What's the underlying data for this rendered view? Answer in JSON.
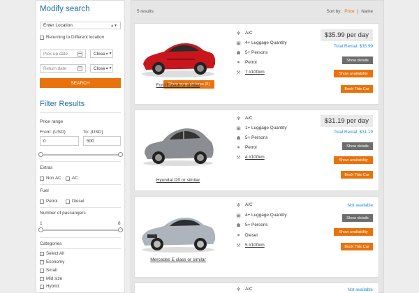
{
  "modify": {
    "title": "Modify search",
    "location": "Enter Location",
    "return_diff": "Returning to Different location",
    "pickup_placeholder": "Pick-up date",
    "return_placeholder": "Return date",
    "time_closed_1": "Close",
    "time_closed_2": "Close",
    "search_btn": "SEARCH"
  },
  "filters": {
    "title": "Filter Results",
    "price_range_label": "Price range",
    "from_label": "From: (USD)",
    "to_label": "To: (USD)",
    "from_value": "0",
    "to_value": "500",
    "extras_label": "Extras",
    "extras": [
      "Non AC",
      "AC"
    ],
    "fuel_label": "Fuel",
    "fuel": [
      "Petrol",
      "Diesel"
    ],
    "passengers_label": "Number of passangers",
    "pass_min": "1",
    "pass_max": "8",
    "categories_label": "Categories",
    "categories": [
      "Select All",
      "Economy",
      "Small",
      "Mid size",
      "Hybrid"
    ]
  },
  "results": {
    "count_text": "5 results",
    "sort_label": "Sort by:",
    "sort_price": "Price",
    "sort_sep": "|",
    "sort_name": "Name"
  },
  "cars": [
    {
      "name": "Ford Fusion or similar",
      "color": "#c8161d",
      "features": [
        "A/C",
        "4+ Luggage Quantity",
        "5+ Persons",
        "Petrol",
        "7 l/100km"
      ],
      "price": "$35.99 per day",
      "total": "Total Rental: $35.99",
      "more_pictures": "Show more pictures (5)",
      "show_details": "Show details",
      "show_availability": "Show availability",
      "book": "Book This Car"
    },
    {
      "name": "Hyundai i20 or similar",
      "color": "#8a8d91",
      "features": [
        "A/C",
        "1+ Luggage Quantity",
        "5+ Persons",
        "Petrol",
        "4 l/100km"
      ],
      "price": "$31.19 per day",
      "total": "Total Rental: $31.19",
      "show_details": "Show details",
      "show_availability": "Show availability",
      "book": "Book This Car"
    },
    {
      "name": "Mercedes E class or similar",
      "color": "#aeb4bb",
      "features": [
        "A/C",
        "4+ Luggage Quantity",
        "5+ Persons",
        "Diesel",
        "5 l/100km"
      ],
      "not_available": "Not available",
      "show_details": "Show details",
      "show_availability": "Show availability",
      "book": "Book This Car"
    },
    {
      "features": [
        "A/C"
      ],
      "not_available": "Not available"
    }
  ],
  "icons": {
    "ac": "snowflake-icon",
    "luggage": "briefcase-icon",
    "persons": "people-icon",
    "fuel": "droplet-icon",
    "consumption": "wrench-icon"
  },
  "colors": {
    "accent": "#e8730c",
    "heading": "#1f6fa8",
    "link": "#1f8fcf",
    "grey_button": "#6d6d6d"
  }
}
